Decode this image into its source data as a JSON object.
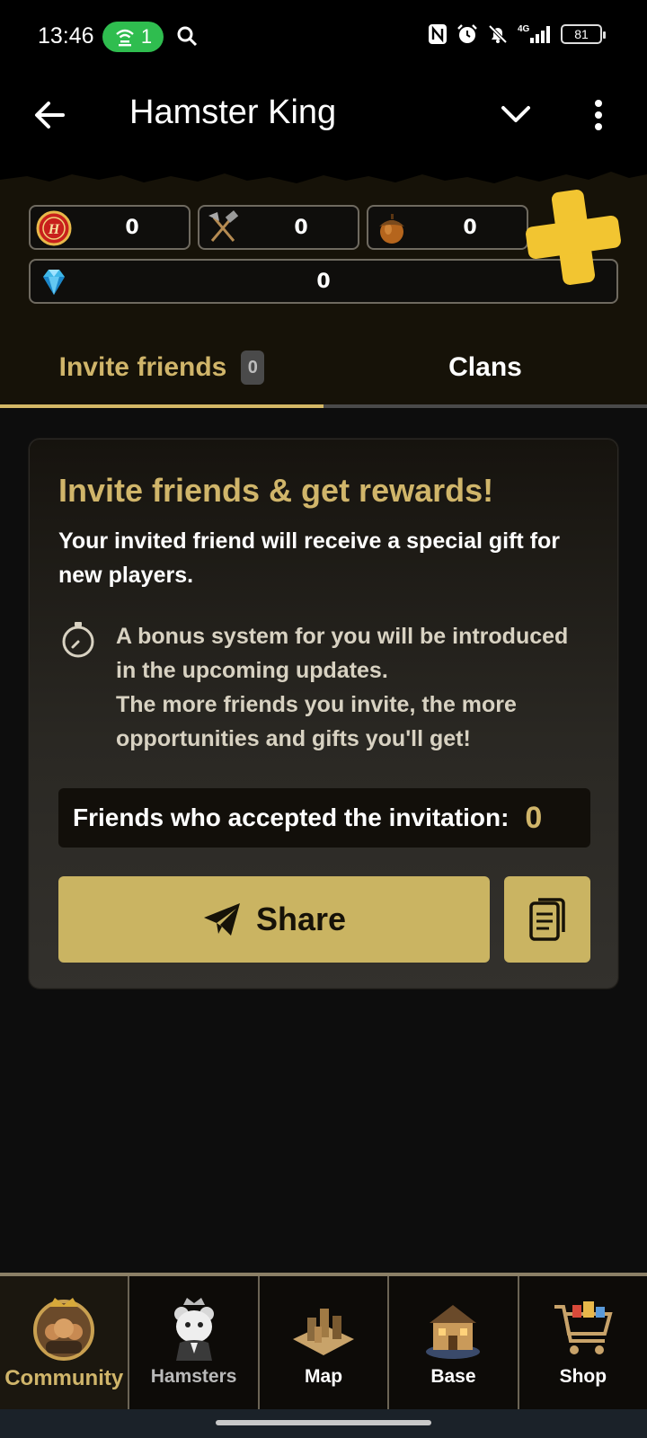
{
  "status_bar": {
    "time": "13:46",
    "hotspot_count": "1",
    "battery": "81"
  },
  "app_bar": {
    "title": "Hamster King"
  },
  "resources": {
    "coins": "0",
    "tools": "0",
    "acorns": "0",
    "gems": "0"
  },
  "tabs": [
    {
      "label": "Invite friends",
      "badge": "0"
    },
    {
      "label": "Clans"
    }
  ],
  "card": {
    "title": "Invite friends & get rewards!",
    "subtitle": "Your invited friend will receive a special gift for new players.",
    "bonus_lines": [
      "A bonus system for you will be introduced",
      "in the upcoming updates.",
      "The more friends you invite, the more",
      "opportunities and gifts you'll get!"
    ],
    "accepted_label": "Friends who accepted the invitation:",
    "accepted_count": "0",
    "share_label": "Share"
  },
  "bottom_nav": [
    {
      "label": "Community"
    },
    {
      "label": "Hamsters"
    },
    {
      "label": "Map"
    },
    {
      "label": "Base"
    },
    {
      "label": "Shop"
    }
  ],
  "colors": {
    "accent_gold": "#d0b56a",
    "button_gold": "#cab462",
    "hotspot_green": "#2fbd4f"
  }
}
